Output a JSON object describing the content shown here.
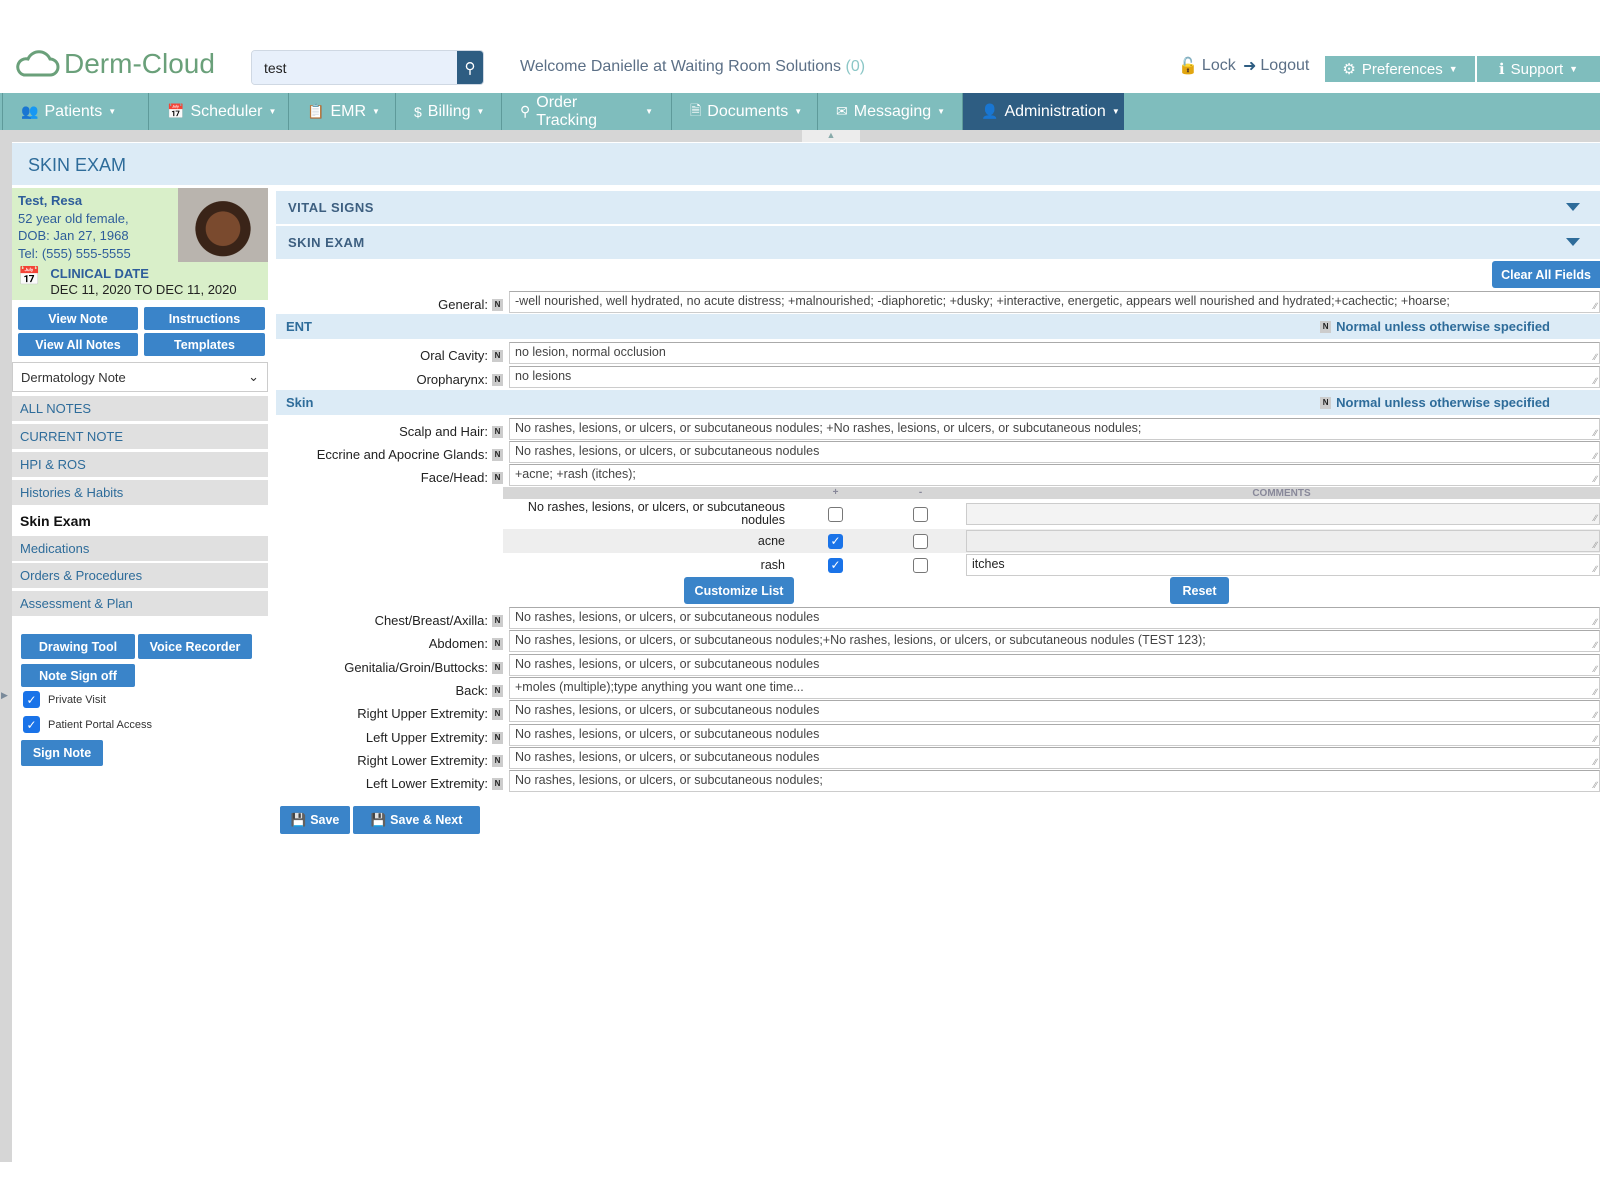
{
  "app": {
    "logo": "Derm-Cloud",
    "search_value": "test",
    "welcome": "Welcome Danielle at Waiting Room Solutions",
    "welcome_count": "(0)",
    "lock": "Lock",
    "logout": "Logout",
    "preferences": "Preferences",
    "support": "Support"
  },
  "nav": [
    {
      "label": "Patients",
      "icon": "users-icon"
    },
    {
      "label": "Scheduler",
      "icon": "calendar-icon"
    },
    {
      "label": "EMR",
      "icon": "copy-icon"
    },
    {
      "label": "Billing",
      "icon": "dollar-icon"
    },
    {
      "label": "Order Tracking",
      "icon": "search-icon"
    },
    {
      "label": "Documents",
      "icon": "document-icon"
    },
    {
      "label": "Messaging",
      "icon": "envelope-icon"
    },
    {
      "label": "Administration",
      "icon": "user-icon",
      "active": true
    }
  ],
  "page_title": "SKIN EXAM",
  "patient": {
    "name": "Test, Resa",
    "age_sex": "52 year old female,",
    "dob": "DOB: Jan 27, 1968",
    "tel": "Tel: (555) 555-5555",
    "clinical_date_label": "CLINICAL DATE",
    "clinical_date": "DEC 11, 2020 TO DEC 11, 2020"
  },
  "sidebar": {
    "buttons": {
      "view_note": "View Note",
      "instructions": "Instructions",
      "view_all": "View All Notes",
      "templates": "Templates"
    },
    "note_type": "Dermatology Note",
    "items": [
      "ALL NOTES",
      "CURRENT NOTE",
      "HPI & ROS",
      "Histories & Habits",
      "Skin Exam",
      "Medications",
      "Orders & Procedures",
      "Assessment & Plan"
    ],
    "drawing_tool": "Drawing Tool",
    "voice_recorder": "Voice Recorder",
    "note_sign_off": "Note Sign off",
    "private_visit": "Private Visit",
    "private_visit_checked": true,
    "portal_access": "Patient Portal Access",
    "portal_access_checked": true,
    "sign_note": "Sign Note"
  },
  "main": {
    "vital_signs": "VITAL SIGNS",
    "skin_exam": "SKIN EXAM",
    "clear_all": "Clear All Fields",
    "nus": "Normal unless otherwise specified",
    "n": "N",
    "general": {
      "label": "General:",
      "value": "-well nourished, well hydrated, no acute distress;  +malnourished;  -diaphoretic;  +dusky;  +interactive, energetic, appears well nourished and hydrated;+cachectic; +hoarse;"
    },
    "ent": "ENT",
    "skin": "Skin",
    "ent_rows": [
      {
        "label": "Oral Cavity:",
        "value": "no lesion, normal occlusion"
      },
      {
        "label": "Oropharynx:",
        "value": "no lesions"
      }
    ],
    "skin_rows_a": [
      {
        "label": "Scalp and Hair:",
        "value": "No rashes, lesions, or ulcers, or subcutaneous nodules; +No rashes, lesions, or ulcers, or subcutaneous nodules;"
      },
      {
        "label": "Eccrine and Apocrine Glands:",
        "value": "No rashes, lesions, or ulcers, or subcutaneous nodules"
      },
      {
        "label": "Face/Head:",
        "value": "+acne; +rash (itches);"
      }
    ],
    "findings": {
      "plus": "+",
      "minus": "-",
      "comments": "COMMENTS",
      "rows": [
        {
          "label": "No rashes, lesions, or ulcers, or subcutaneous nodules",
          "plus": false,
          "minus": false,
          "comment": ""
        },
        {
          "label": "acne",
          "plus": true,
          "minus": false,
          "comment": ""
        },
        {
          "label": "rash",
          "plus": true,
          "minus": false,
          "comment": "itches"
        }
      ],
      "customize": "Customize List",
      "reset": "Reset"
    },
    "skin_rows_b": [
      {
        "label": "Chest/Breast/Axilla:",
        "value": "No rashes, lesions, or ulcers, or subcutaneous nodules"
      },
      {
        "label": "Abdomen:",
        "value": "No rashes, lesions, or ulcers, or subcutaneous nodules;+No rashes, lesions, or ulcers, or subcutaneous nodules (TEST 123);"
      },
      {
        "label": "Genitalia/Groin/Buttocks:",
        "value": "No rashes, lesions, or ulcers, or subcutaneous nodules"
      },
      {
        "label": "Back:",
        "value": "+moles (multiple);type anything you want one time..."
      },
      {
        "label": "Right Upper Extremity:",
        "value": "No rashes, lesions, or ulcers, or subcutaneous nodules"
      },
      {
        "label": "Left Upper Extremity:",
        "value": "No rashes, lesions, or ulcers, or subcutaneous nodules"
      },
      {
        "label": "Right Lower Extremity:",
        "value": "No rashes, lesions, or ulcers, or subcutaneous nodules"
      },
      {
        "label": "Left Lower Extremity:",
        "value": "No rashes, lesions, or ulcers, or subcutaneous nodules;"
      }
    ],
    "save": "Save",
    "save_next": "Save & Next"
  }
}
